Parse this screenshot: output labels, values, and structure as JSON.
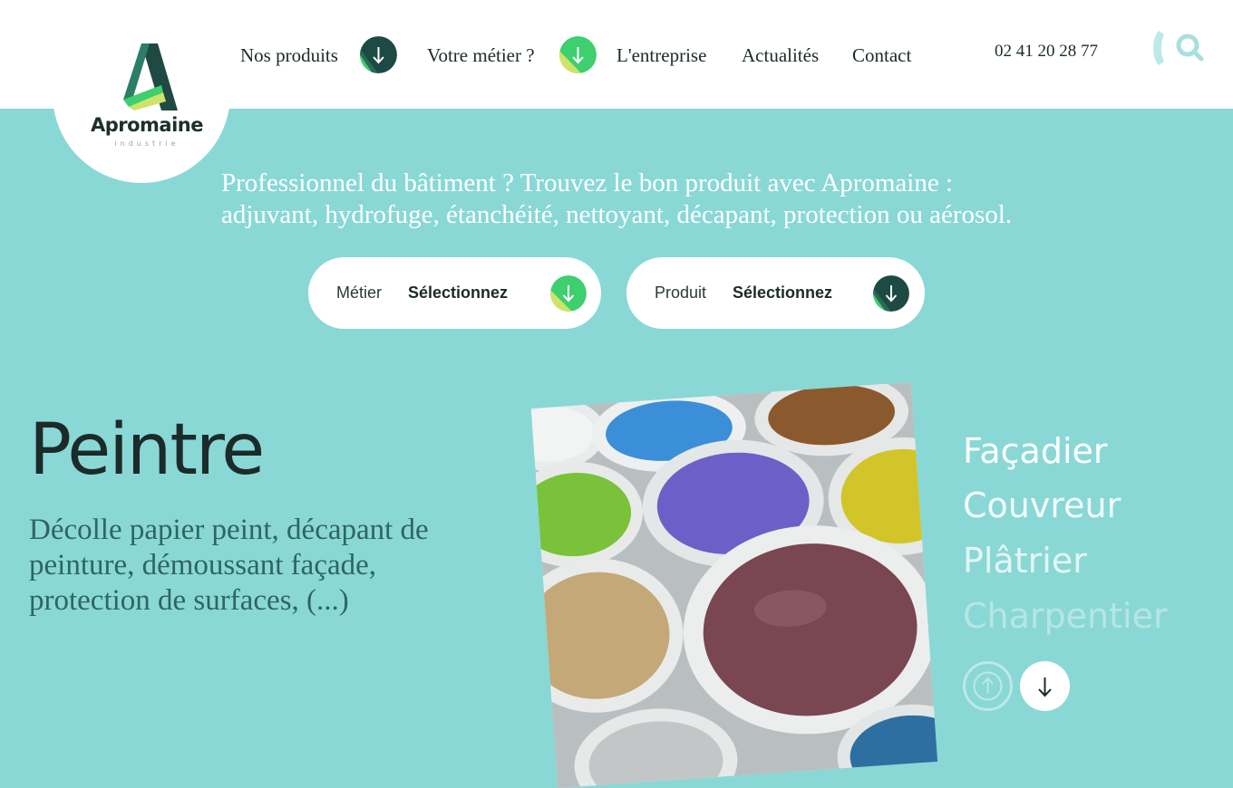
{
  "header": {
    "logo": {
      "name": "Apromaine",
      "subtitle": "industrie"
    },
    "nav": [
      {
        "label": "Nos produits",
        "has_dropdown": true,
        "arrow_style": "dark"
      },
      {
        "label": "Votre métier ?",
        "has_dropdown": true,
        "arrow_style": "green"
      },
      {
        "label": "L'entreprise"
      },
      {
        "label": "Actualités"
      },
      {
        "label": "Contact"
      }
    ],
    "phone": "02 41 20 28 77",
    "search_icon": "search-icon"
  },
  "hero": {
    "tagline_line1": "Professionnel du bâtiment ? Trouvez le bon produit avec Apromaine :",
    "tagline_line2": "adjuvant, hydrofuge, étanchéité, nettoyant, décapant, protection ou aérosol.",
    "selectors": [
      {
        "label": "Métier",
        "value": "Sélectionnez",
        "arrow_style": "green"
      },
      {
        "label": "Produit",
        "value": "Sélectionnez",
        "arrow_style": "dark"
      }
    ]
  },
  "slide": {
    "title": "Peintre",
    "description": "Décolle papier peint, décapant de peinture, démoussant façade, protection de surfaces, (...)",
    "image_alt": "Pots de peinture ouverts de différentes couleurs"
  },
  "trades": [
    "Façadier",
    "Couvreur",
    "Plâtrier",
    "Charpentier"
  ],
  "controls": {
    "up_icon": "arrow-up-icon",
    "down_icon": "arrow-down-icon"
  },
  "colors": {
    "background": "#89d8d6",
    "dark_green": "#1f4a44",
    "bright_green": "#3ecf6e",
    "lime": "#cfe26a",
    "text_dark": "#1b2b2a"
  }
}
